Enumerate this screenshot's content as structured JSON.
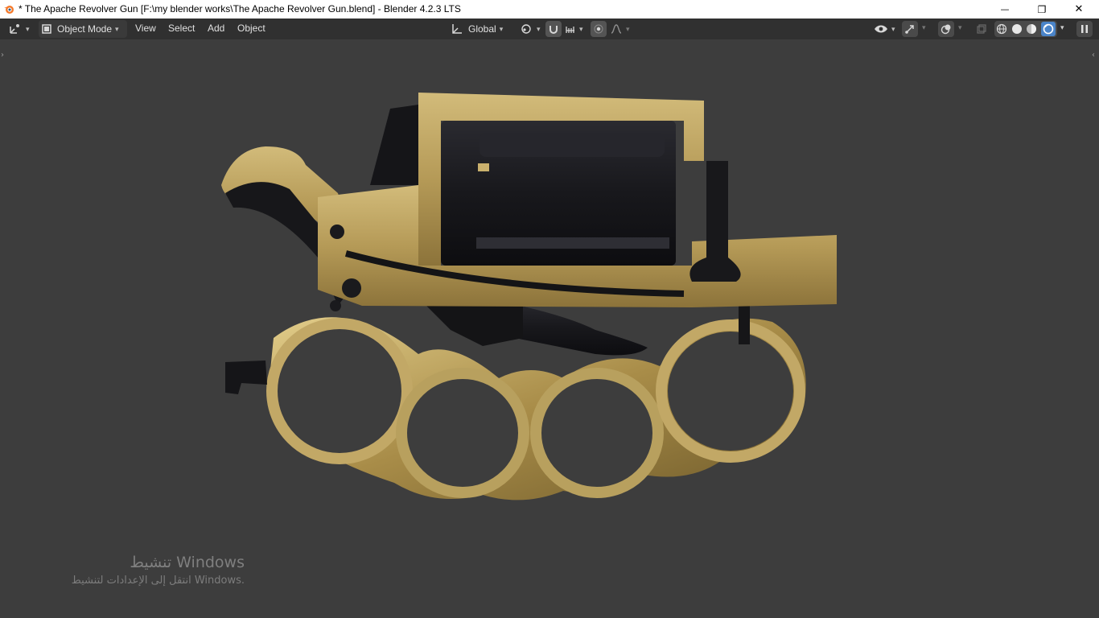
{
  "window": {
    "title": "* The Apache Revolver Gun [F:\\my blender works\\The Apache Revolver Gun.blend] - Blender 4.2.3 LTS",
    "minimize_glyph": "—",
    "restore_glyph": "❐",
    "close_glyph": "✕"
  },
  "header": {
    "mode_label": "Object Mode",
    "menus": [
      "View",
      "Select",
      "Add",
      "Object"
    ],
    "orientation_label": "Global"
  },
  "watermark": {
    "title": "تنشيط Windows",
    "subtitle": "انتقل إلى الإعدادات لتنشيط Windows."
  },
  "colors": {
    "titlebar_bg": "#ffffff",
    "header_bg": "#303030",
    "viewport_bg": "#3d3d3d",
    "active_shading": "#4a84c9",
    "brass": "#b59a57",
    "gunmetal": "#1e1e22"
  },
  "icons": [
    "blender-logo-icon",
    "editor-type-icon",
    "object-mode-icon",
    "transform-orientation-icon",
    "pivot-icon",
    "snap-icon",
    "snap-increment-icon",
    "proportional-edit-icon",
    "falloff-icon",
    "visibility-icon",
    "gizmo-icon",
    "overlay-icon",
    "xray-icon",
    "wireframe-shading-icon",
    "solid-shading-icon",
    "material-shading-icon",
    "rendered-shading-icon",
    "pause-icon"
  ]
}
